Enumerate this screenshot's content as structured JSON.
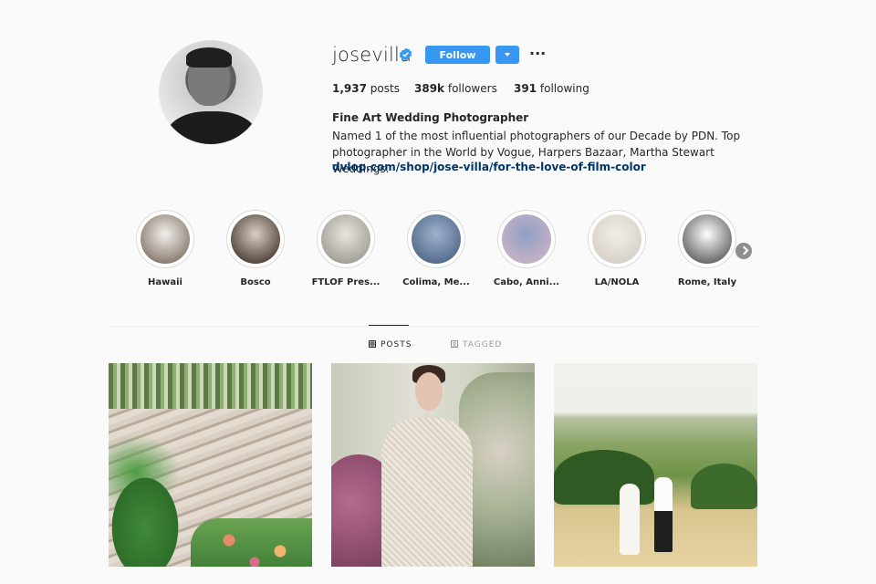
{
  "profile": {
    "username": "josevilla",
    "follow_label": "Follow",
    "more_label": "···",
    "stats": {
      "posts_count": "1,937",
      "posts_label": "posts",
      "followers_count": "389k",
      "followers_label": "followers",
      "following_count": "391",
      "following_label": "following"
    },
    "full_name": "Fine Art Wedding Photographer",
    "bio": "Named 1 of the most influential photographers of our Decade by PDN. Top photographer in the World by Vogue, Harpers Bazaar, Martha Stewart Weddings.",
    "link": "dvlop.com/shop/jose-villa/for-the-love-of-film-color"
  },
  "highlights": [
    {
      "label": "Hawaii",
      "colors": [
        "#f2f0ec",
        "#6a5a4c"
      ]
    },
    {
      "label": "Bosco",
      "colors": [
        "#d9cfc2",
        "#2a1a12"
      ]
    },
    {
      "label": "FTLOF Pres...",
      "colors": [
        "#e9e6df",
        "#8b8a83"
      ]
    },
    {
      "label": "Colima, Me...",
      "colors": [
        "#9fb2cc",
        "#3d577a"
      ]
    },
    {
      "label": "Cabo, Anni...",
      "colors": [
        "#8ea0c4",
        "#d9b6c8"
      ]
    },
    {
      "label": "LA/NOLA",
      "colors": [
        "#f1eee9",
        "#cfc8bf"
      ]
    },
    {
      "label": "Rome, Italy",
      "colors": [
        "#ffffff",
        "#3a3a3a"
      ]
    }
  ],
  "tabs": {
    "posts": "POSTS",
    "tagged": "TAGGED"
  },
  "colors": {
    "accent": "#3897f0",
    "link": "#003569",
    "verified": "#3897f0"
  }
}
